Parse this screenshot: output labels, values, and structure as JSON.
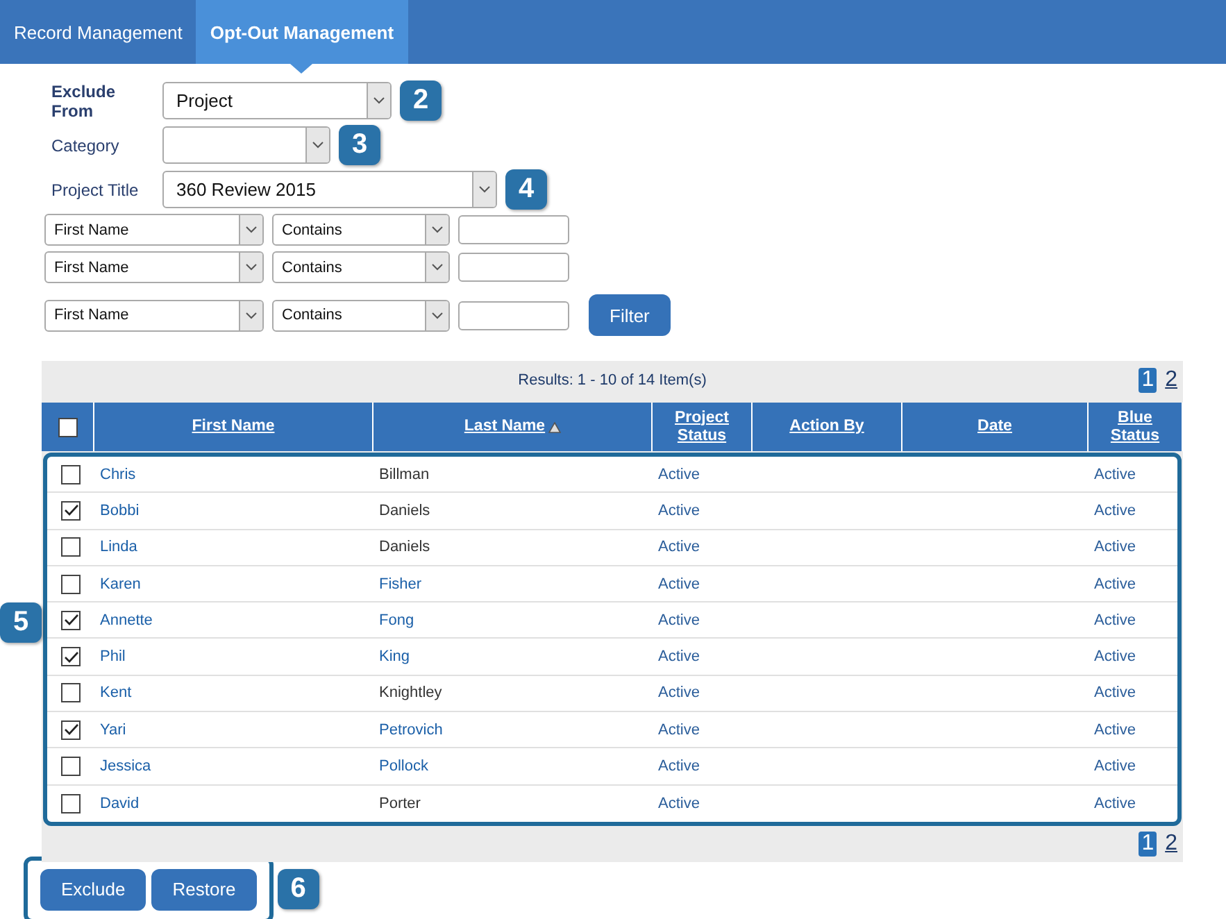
{
  "tabs": [
    {
      "label": "Record Management",
      "selected": false
    },
    {
      "label": "Opt-Out Management",
      "selected": true
    }
  ],
  "form": {
    "exclude_from": {
      "label": "Exclude From",
      "value": "Project",
      "callout": "2"
    },
    "category": {
      "label": "Category",
      "callout": "3"
    },
    "project_title": {
      "label": "Project Title",
      "value": "360 Review 2015",
      "callout": "4"
    }
  },
  "filters": [
    {
      "field": "First Name",
      "operator": "Contains"
    },
    {
      "field": "First Name",
      "operator": "Contains"
    },
    {
      "field": "First Name",
      "operator": "Contains"
    }
  ],
  "filter_button": "Filter",
  "results": {
    "summary": "Results: 1 - 10 of 14 Item(s)",
    "pages": [
      {
        "label": "1",
        "selected": true
      },
      {
        "label": "2",
        "selected": false
      }
    ]
  },
  "table": {
    "select_all_checked": false,
    "columns": [
      {
        "label": "First Name",
        "sorted": false
      },
      {
        "label": "Last Name",
        "sorted": true
      },
      {
        "label": "Project Status",
        "sorted": false
      },
      {
        "label": "Action By",
        "sorted": false
      },
      {
        "label": "Date",
        "sorted": false
      },
      {
        "label": "Blue Status",
        "sorted": false
      }
    ],
    "rows": [
      {
        "checked": false,
        "first_name": "Chris",
        "last_name": "Billman",
        "last_name_link": false,
        "project_status": "Active",
        "blue_status": "Active"
      },
      {
        "checked": true,
        "first_name": "Bobbi",
        "last_name": "Daniels",
        "last_name_link": false,
        "project_status": "Active",
        "blue_status": "Active"
      },
      {
        "checked": false,
        "first_name": "Linda",
        "last_name": "Daniels",
        "last_name_link": false,
        "project_status": "Active",
        "blue_status": "Active"
      },
      {
        "checked": false,
        "first_name": "Karen",
        "last_name": "Fisher",
        "last_name_link": true,
        "project_status": "Active",
        "blue_status": "Active"
      },
      {
        "checked": true,
        "first_name": "Annette",
        "last_name": "Fong",
        "last_name_link": true,
        "project_status": "Active",
        "blue_status": "Active"
      },
      {
        "checked": true,
        "first_name": "Phil",
        "last_name": "King",
        "last_name_link": true,
        "project_status": "Active",
        "blue_status": "Active"
      },
      {
        "checked": false,
        "first_name": "Kent",
        "last_name": "Knightley",
        "last_name_link": false,
        "project_status": "Active",
        "blue_status": "Active"
      },
      {
        "checked": true,
        "first_name": "Yari",
        "last_name": "Petrovich",
        "last_name_link": true,
        "project_status": "Active",
        "blue_status": "Active"
      },
      {
        "checked": false,
        "first_name": "Jessica",
        "last_name": "Pollock",
        "last_name_link": true,
        "project_status": "Active",
        "blue_status": "Active"
      },
      {
        "checked": false,
        "first_name": "David",
        "last_name": "Porter",
        "last_name_link": false,
        "project_status": "Active",
        "blue_status": "Active"
      }
    ],
    "rows_callout": "5"
  },
  "footer_pages": [
    {
      "label": "1",
      "selected": true
    },
    {
      "label": "2",
      "selected": false
    }
  ],
  "actions": {
    "buttons": [
      "Exclude",
      "Restore"
    ],
    "callout": "6"
  }
}
